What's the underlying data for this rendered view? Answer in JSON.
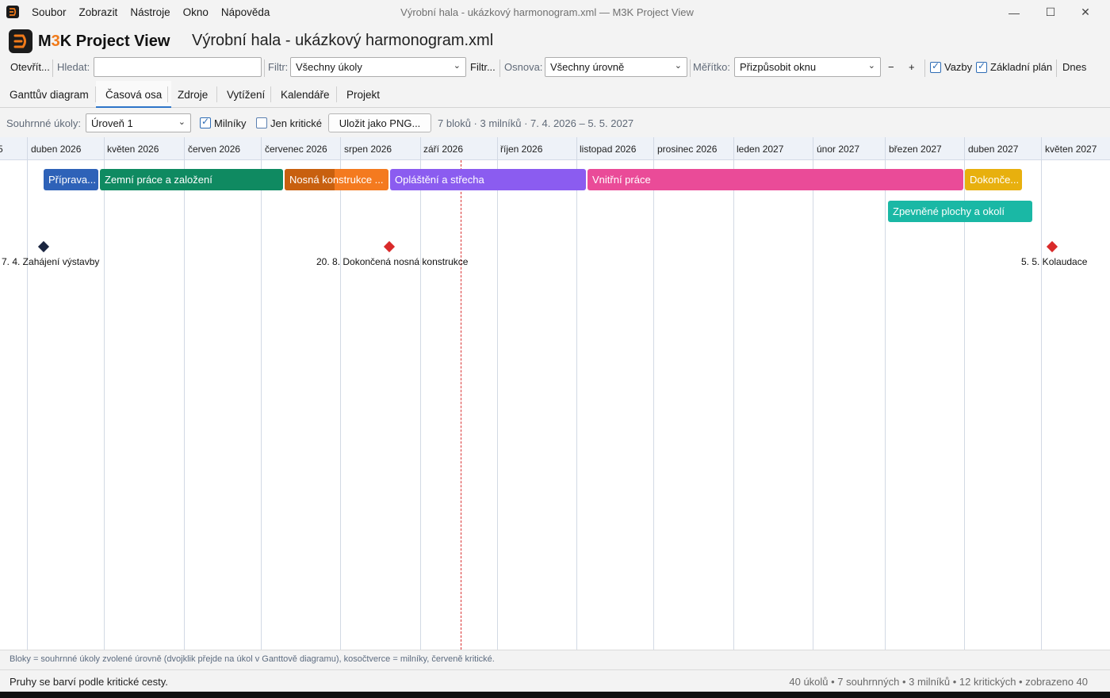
{
  "window": {
    "title": "Výrobní hala - ukázkový harmonogram.xml — M3K Project View",
    "minimize": "—",
    "maximize": "☐",
    "close": "✕"
  },
  "menu": [
    "Soubor",
    "Zobrazit",
    "Nástroje",
    "Okno",
    "Nápověda"
  ],
  "header": {
    "brand_a": "M",
    "brand_b": "3",
    "brand_c": "K Project View",
    "file_title": "Výrobní hala - ukázkový harmonogram.xml"
  },
  "toolbar": {
    "open": "Otevřít...",
    "search_label": "Hledat:",
    "search_value": "",
    "filter_label": "Filtr:",
    "filter_value": "Všechny úkoly",
    "filter_more": "Filtr...",
    "outline_label": "Osnova:",
    "outline_value": "Všechny úrovně",
    "scale_label": "Měřítko:",
    "scale_value": "Přizpůsobit oknu",
    "zoom_out": "−",
    "zoom_in": "+",
    "links_label": "Vazby",
    "links_checked": true,
    "baseline_label": "Základní plán",
    "baseline_checked": true,
    "today": "Dnes"
  },
  "tabs": [
    "Ganttův diagram",
    "Časová osa",
    "Zdroje",
    "Vytížení",
    "Kalendáře",
    "Projekt"
  ],
  "active_tab": "Časová osa",
  "options": {
    "summary_label": "Souhrnné úkoly:",
    "summary_value": "Úroveň 1",
    "milestones_label": "Milníky",
    "milestones_checked": true,
    "critical_label": "Jen kritické",
    "critical_checked": false,
    "save_png": "Uložit jako PNG...",
    "summary_info": "7 bloků · 3 milníků · 7. 4. 2026 – 5. 5. 2027"
  },
  "timeline": {
    "months": [
      "5",
      "duben 2026",
      "květen 2026",
      "červen 2026",
      "červenec 2026",
      "srpen 2026",
      "září 2026",
      "říjen 2026",
      "listopad 2026",
      "prosinec 2026",
      "leden 2027",
      "únor 2027",
      "březen 2027",
      "duben 2027",
      "květen 2027"
    ],
    "blocks": [
      {
        "label": "Příprava...",
        "color": "#2e62b8"
      },
      {
        "label": "Zemní práce a založení",
        "color": "#0f8a61"
      },
      {
        "label": "Nosná konstrukce ...",
        "color": "#f47a1f",
        "shade": "#c8600f"
      },
      {
        "label": "Opláštění a střecha",
        "color": "#8b5cf0"
      },
      {
        "label": "Vnitřní práce",
        "color": "#ea4b98"
      },
      {
        "label": "Dokonče...",
        "color": "#e8b00e"
      },
      {
        "label": "Zpevněné plochy a okolí",
        "color": "#1ab8a5"
      }
    ],
    "milestones": [
      {
        "label": "7. 4. Zahájení výstavby",
        "color": "#1a2540"
      },
      {
        "label": "20. 8. Dokončená nosná konstrukce",
        "color": "#d92a2a"
      },
      {
        "label": "5. 5. Kolaudace",
        "color": "#d92a2a"
      }
    ]
  },
  "legend": "Bloky = souhrnné úkoly zvolené úrovně (dvojklik přejde na úkol v Ganttově diagramu), kosočtverce = milníky, červeně kritické.",
  "status": {
    "left": "Pruhy se barví podle kritické cesty.",
    "right": "40 úkolů  •  7 souhrnných  •  3 milníků  •  12 kritických  •  zobrazeno 40"
  }
}
